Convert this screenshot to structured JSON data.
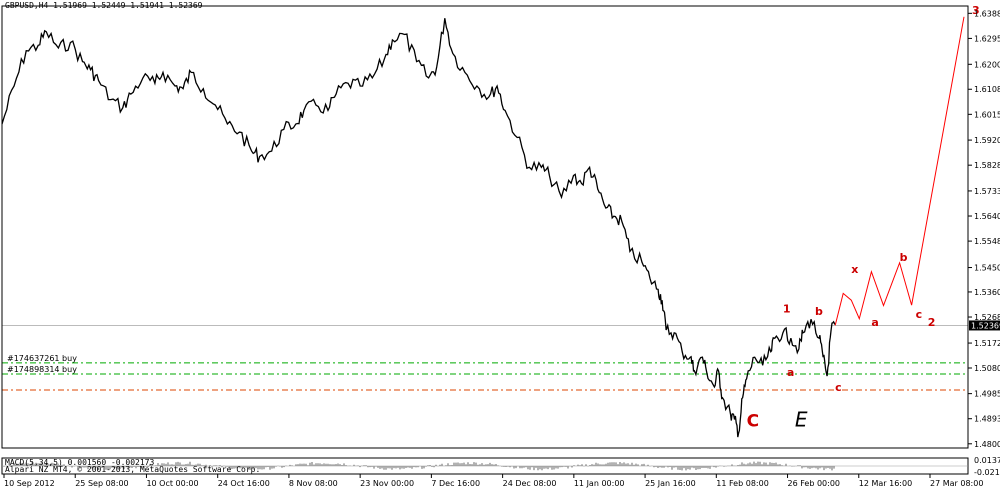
{
  "header": {
    "symbol_line": "GBPUSD,H4  1.51969 1.52449 1.51941 1.52369"
  },
  "indicator": {
    "label": "MACD(5,34,5) 0.001560 -0.002173",
    "y_ticks": [
      "0.013795",
      "-0.02149"
    ]
  },
  "footer": {
    "copyright": "Alpari NZ MT4, © 2001-2013, MetaQuotes Software Corp."
  },
  "orders": [
    {
      "label": "#174637261 buy",
      "price": 1.5099,
      "color": "#00aa00"
    },
    {
      "label": "#174898314 buy",
      "price": 1.5058,
      "color": "#00aa00"
    },
    {
      "label": "",
      "price": 1.4999,
      "color": "#dd4400"
    }
  ],
  "current_price": {
    "label": "1.52369",
    "value": 1.52369
  },
  "colors": {
    "price": "#000000",
    "forecast": "#ff0000",
    "grid_line": "#bbbbbb",
    "wave_text": "#cc0000"
  },
  "chart_data": {
    "type": "line",
    "title": "GBPUSD,H4",
    "ylim": [
      1.4785,
      1.6415
    ],
    "y_ticks": [
      "1.63880",
      "1.62955",
      "1.62000",
      "1.61080",
      "1.60155",
      "1.59205",
      "1.58280",
      "1.57330",
      "1.56405",
      "1.55480",
      "1.54505",
      "1.53605",
      "1.52680",
      "1.51720",
      "1.50800",
      "1.49855",
      "1.48930",
      "1.48005"
    ],
    "x_tick_labels": [
      "10 Sep 2012",
      "25 Sep 08:00",
      "10 Oct 00:00",
      "24 Oct 16:00",
      "8 Nov 08:00",
      "23 Nov 00:00",
      "7 Dec 16:00",
      "24 Dec 08:00",
      "11 Jan 00:00",
      "25 Jan 16:00",
      "11 Feb 08:00",
      "26 Feb 00:00",
      "12 Mar 16:00",
      "27 Mar 08:00"
    ],
    "x_range": [
      "2012-09-10",
      "2013-05-08"
    ],
    "series": [
      {
        "name": "GBPUSD",
        "points": [
          [
            "2012-09-10",
            1.598
          ],
          [
            "2012-09-13",
            1.612
          ],
          [
            "2012-09-16",
            1.625
          ],
          [
            "2012-09-19",
            1.627
          ],
          [
            "2012-09-21",
            1.632
          ],
          [
            "2012-09-24",
            1.626
          ],
          [
            "2012-09-27",
            1.628
          ],
          [
            "2012-09-30",
            1.621
          ],
          [
            "2012-10-02",
            1.618
          ],
          [
            "2012-10-04",
            1.614
          ],
          [
            "2012-10-07",
            1.607
          ],
          [
            "2012-10-10",
            1.604
          ],
          [
            "2012-10-12",
            1.609
          ],
          [
            "2012-10-15",
            1.615
          ],
          [
            "2012-10-18",
            1.613
          ],
          [
            "2012-10-20",
            1.617
          ],
          [
            "2012-10-23",
            1.612
          ],
          [
            "2012-10-25",
            1.611
          ],
          [
            "2012-10-27",
            1.617
          ],
          [
            "2012-10-30",
            1.611
          ],
          [
            "2012-11-02",
            1.605
          ],
          [
            "2012-11-05",
            1.598
          ],
          [
            "2012-11-08",
            1.595
          ],
          [
            "2012-11-11",
            1.588
          ],
          [
            "2012-11-13",
            1.586
          ],
          [
            "2012-11-16",
            1.588
          ],
          [
            "2012-11-19",
            1.596
          ],
          [
            "2012-11-22",
            1.598
          ],
          [
            "2012-11-24",
            1.603
          ],
          [
            "2012-11-27",
            1.605
          ],
          [
            "2012-11-30",
            1.603
          ],
          [
            "2012-12-02",
            1.609
          ],
          [
            "2012-12-05",
            1.613
          ],
          [
            "2012-12-08",
            1.612
          ],
          [
            "2012-12-11",
            1.615
          ],
          [
            "2012-12-14",
            1.622
          ],
          [
            "2012-12-16",
            1.629
          ],
          [
            "2012-12-19",
            1.631
          ],
          [
            "2012-12-22",
            1.621
          ],
          [
            "2012-12-25",
            1.615
          ],
          [
            "2012-12-27",
            1.619
          ],
          [
            "2012-12-29",
            1.637
          ],
          [
            "2012-12-31",
            1.624
          ],
          [
            "2013-01-03",
            1.617
          ],
          [
            "2013-01-06",
            1.612
          ],
          [
            "2013-01-09",
            1.608
          ],
          [
            "2013-01-11",
            1.612
          ],
          [
            "2013-01-13",
            1.603
          ],
          [
            "2013-01-16",
            1.593
          ],
          [
            "2013-01-19",
            1.582
          ],
          [
            "2013-01-22",
            1.582
          ],
          [
            "2013-01-24",
            1.579
          ],
          [
            "2013-01-27",
            1.571
          ],
          [
            "2013-01-30",
            1.579
          ],
          [
            "2013-02-01",
            1.576
          ],
          [
            "2013-02-03",
            1.582
          ],
          [
            "2013-02-05",
            1.574
          ],
          [
            "2013-02-07",
            1.567
          ],
          [
            "2013-02-09",
            1.564
          ],
          [
            "2013-02-11",
            1.562
          ],
          [
            "2013-02-13",
            1.551
          ],
          [
            "2013-02-16",
            1.547
          ],
          [
            "2013-02-18",
            1.541
          ],
          [
            "2013-02-20",
            1.537
          ],
          [
            "2013-02-21",
            1.533
          ],
          [
            "2013-02-22",
            1.522
          ],
          [
            "2013-02-24",
            1.521
          ],
          [
            "2013-02-26",
            1.514
          ],
          [
            "2013-02-28",
            1.512
          ],
          [
            "2013-03-01",
            1.507
          ],
          [
            "2013-03-03",
            1.512
          ],
          [
            "2013-03-04",
            1.507
          ],
          [
            "2013-03-06",
            1.501
          ],
          [
            "2013-03-07",
            1.507
          ],
          [
            "2013-03-08",
            1.497
          ],
          [
            "2013-03-10",
            1.491
          ],
          [
            "2013-03-11",
            1.489
          ],
          [
            "2013-03-12",
            1.484
          ],
          [
            "2013-03-13",
            1.497
          ],
          [
            "2013-03-14",
            1.504
          ],
          [
            "2013-03-16",
            1.512
          ],
          [
            "2013-03-18",
            1.509
          ],
          [
            "2013-03-20",
            1.514
          ],
          [
            "2013-03-21",
            1.519
          ],
          [
            "2013-03-23",
            1.521
          ],
          [
            "2013-03-25",
            1.519
          ],
          [
            "2013-03-27",
            1.515
          ],
          [
            "2013-03-28",
            1.521
          ],
          [
            "2013-03-30",
            1.526
          ],
          [
            "2013-04-01",
            1.519
          ],
          [
            "2013-04-02",
            1.512
          ],
          [
            "2013-04-03",
            1.505
          ],
          [
            "2013-04-04",
            1.522
          ],
          [
            "2013-04-05",
            1.524
          ]
        ]
      },
      {
        "name": "",
        "points": [
          [
            "2013-04-05",
            1.5237
          ],
          [
            "2013-04-07",
            1.5355
          ],
          [
            "2013-04-09",
            1.533
          ],
          [
            "2013-04-11",
            1.5262
          ],
          [
            "2013-04-14",
            1.5435
          ],
          [
            "2013-04-17",
            1.531
          ],
          [
            "2013-04-21",
            1.5468
          ],
          [
            "2013-04-24",
            1.5312
          ],
          [
            "2013-05-07",
            1.6375
          ]
        ]
      }
    ],
    "annotations": [
      {
        "text": "1",
        "date": "2013-03-23",
        "price": 1.5285,
        "size": "small"
      },
      {
        "text": "b",
        "date": "2013-03-31",
        "price": 1.5275,
        "size": "small"
      },
      {
        "text": "x",
        "date": "2013-04-09",
        "price": 1.543,
        "size": "small"
      },
      {
        "text": "b",
        "date": "2013-04-21",
        "price": 1.5475,
        "size": "small"
      },
      {
        "text": "a",
        "date": "2013-03-24",
        "price": 1.505,
        "size": "small"
      },
      {
        "text": "a",
        "date": "2013-04-14",
        "price": 1.5235,
        "size": "small"
      },
      {
        "text": "c",
        "date": "2013-04-05",
        "price": 1.4995,
        "size": "small"
      },
      {
        "text": "c",
        "date": "2013-04-25",
        "price": 1.5265,
        "size": "small"
      },
      {
        "text": "2",
        "date": "2013-04-28",
        "price": 1.5235,
        "size": "small"
      },
      {
        "text": "3",
        "date": "2013-05-09",
        "price": 1.6385,
        "size": "small"
      },
      {
        "text": "C",
        "date": "2013-03-14",
        "price": 1.4865,
        "size": "large"
      }
    ],
    "wave_label_black": {
      "text": "E",
      "date": "2013-03-26",
      "price": 1.4865
    }
  }
}
